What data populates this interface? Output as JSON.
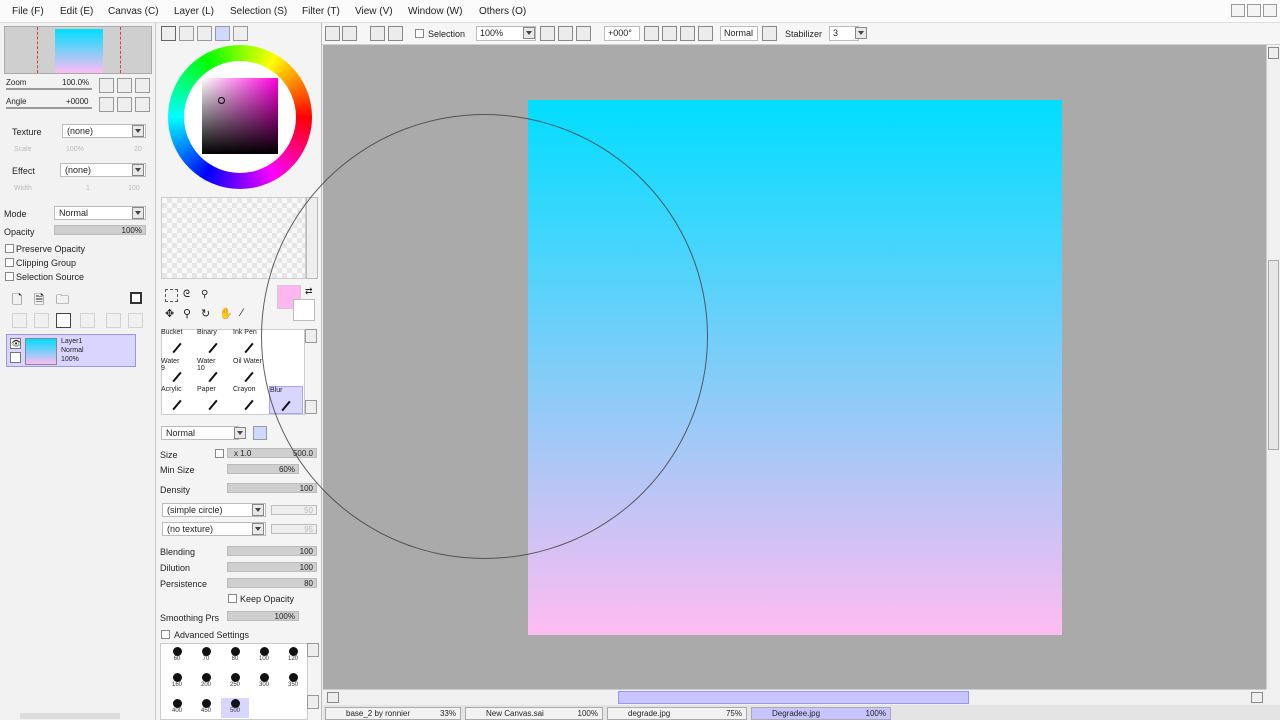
{
  "menu": [
    "File (F)",
    "Edit (E)",
    "Canvas (C)",
    "Layer (L)",
    "Selection (S)",
    "Filter (T)",
    "View (V)",
    "Window (W)",
    "Others (O)"
  ],
  "toolbar": {
    "selection_label": "Selection",
    "zoom": "100%",
    "angle": "+000°",
    "blend_mode": "Normal",
    "stabilizer_label": "Stabilizer",
    "stabilizer_value": "3"
  },
  "navigator": {
    "zoom_label": "Zoom",
    "zoom_value": "100.0%",
    "angle_label": "Angle",
    "angle_value": "+0000"
  },
  "layer_props": {
    "texture_label": "Texture",
    "texture_value": "(none)",
    "texture_scale_label": "Scale",
    "texture_scale_value": "100%",
    "texture_scale_num": "20",
    "effect_label": "Effect",
    "effect_value": "(none)",
    "effect_width_label": "Width",
    "effect_width_value": "1",
    "effect_width_num": "100",
    "mode_label": "Mode",
    "mode_value": "Normal",
    "opacity_label": "Opacity",
    "opacity_value": "100%",
    "preserve_opacity": "Preserve Opacity",
    "clipping_group": "Clipping Group",
    "selection_source": "Selection Source"
  },
  "layer": {
    "name": "Layer1",
    "mode": "Normal",
    "opacity": "100%"
  },
  "brushes": [
    {
      "name": "Bucket",
      "num": ""
    },
    {
      "name": "Binary",
      "num": ""
    },
    {
      "name": "Ink Pen",
      "num": ""
    },
    {
      "name": "Water",
      "num": "9"
    },
    {
      "name": "Water",
      "num": "10"
    },
    {
      "name": "Oil Water",
      "num": ""
    },
    {
      "name": "Acrylic",
      "num": ""
    },
    {
      "name": "Paper",
      "num": ""
    },
    {
      "name": "Crayon",
      "num": ""
    },
    {
      "name": "Blur",
      "num": ""
    }
  ],
  "tool_settings": {
    "mode": "Normal",
    "size_label": "Size",
    "size_mult": "x 1.0",
    "size_value": "500.0",
    "min_size_label": "Min Size",
    "min_size_value": "60%",
    "density_label": "Density",
    "density_value": "100",
    "shape": "(simple circle)",
    "shape_num": "50",
    "texture": "(no texture)",
    "texture_num": "95",
    "blending_label": "Blending",
    "blending_value": "100",
    "dilution_label": "Dilution",
    "dilution_value": "100",
    "persistence_label": "Persistence",
    "persistence_value": "80",
    "keep_opacity": "Keep Opacity",
    "smoothing_label": "Smoothing Prs",
    "smoothing_value": "100%",
    "advanced": "Advanced Settings"
  },
  "brush_sizes": [
    "60",
    "70",
    "80",
    "100",
    "120",
    "160",
    "200",
    "250",
    "300",
    "350",
    "400",
    "450",
    "500"
  ],
  "documents": [
    {
      "name": "base_2 by ronnier",
      "pct": "33%"
    },
    {
      "name": "New Canvas.sai",
      "pct": "100%"
    },
    {
      "name": "degrade.jpg",
      "pct": "75%"
    },
    {
      "name": "Degradee.jpg",
      "pct": "100%"
    }
  ],
  "colors": {
    "gradient_top": "#00deff",
    "gradient_bottom": "#ffbcf2",
    "primary": "#ffb6f0",
    "accent": "#c8c4ff"
  }
}
